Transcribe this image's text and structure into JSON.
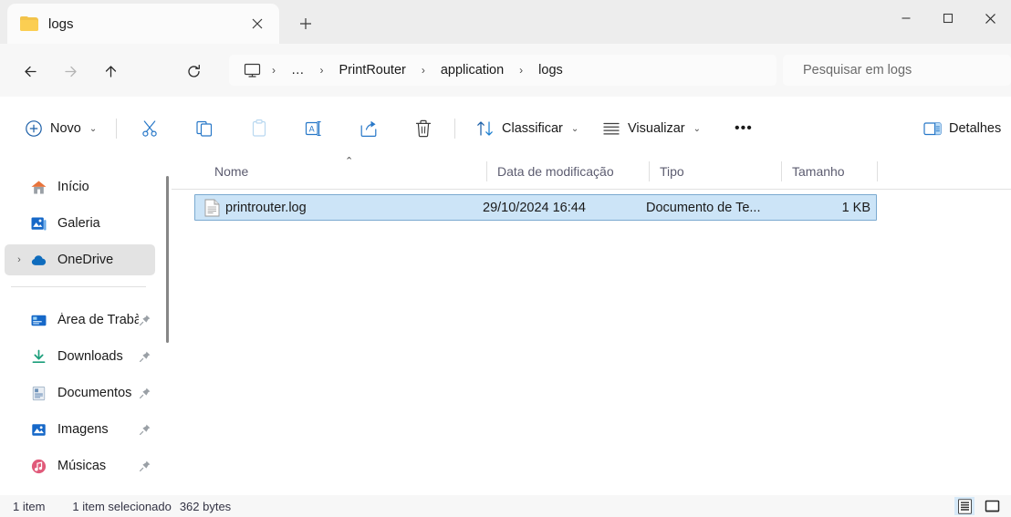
{
  "window": {
    "tab_title": "logs",
    "tab_icon": "folder-icon",
    "close_tab_label": "×",
    "new_tab_label": "+",
    "minimize_label": "─",
    "maximize_label": "□",
    "close_label": "✕"
  },
  "nav": {
    "back": "←",
    "forward": "→",
    "up": "↑",
    "refresh": "↻",
    "breadcrumb": [
      {
        "label": "",
        "icon": "this-pc-icon"
      },
      {
        "label": "…",
        "icon": ""
      },
      {
        "label": "PrintRouter",
        "icon": ""
      },
      {
        "label": "application",
        "icon": ""
      },
      {
        "label": "logs",
        "icon": ""
      }
    ],
    "separator": "›"
  },
  "search": {
    "placeholder": "Pesquisar em logs",
    "value": ""
  },
  "toolbar": {
    "new_label": "Novo",
    "cut_label": "",
    "copy_label": "",
    "paste_label": "",
    "rename_label": "",
    "share_label": "",
    "delete_label": "",
    "sort_label": "Classificar",
    "view_label": "Visualizar",
    "more_label": "•••",
    "details_label": "Detalhes",
    "chevron": "⌄"
  },
  "sidebar": {
    "items": [
      {
        "label": "Início",
        "icon": "home-icon",
        "pinned": false,
        "expandable": false,
        "selected": false
      },
      {
        "label": "Galeria",
        "icon": "gallery-icon",
        "pinned": false,
        "expandable": false,
        "selected": false
      },
      {
        "label": "OneDrive",
        "icon": "cloud-icon",
        "pinned": false,
        "expandable": true,
        "selected": true
      },
      {
        "label": "Área de Trabà",
        "icon": "desktop-icon",
        "pinned": true,
        "expandable": false,
        "selected": false
      },
      {
        "label": "Downloads",
        "icon": "download-icon",
        "pinned": true,
        "expandable": false,
        "selected": false
      },
      {
        "label": "Documentos",
        "icon": "document-icon",
        "pinned": true,
        "expandable": false,
        "selected": false
      },
      {
        "label": "Imagens",
        "icon": "picture-icon",
        "pinned": true,
        "expandable": false,
        "selected": false
      },
      {
        "label": "Músicas",
        "icon": "music-icon",
        "pinned": true,
        "expandable": false,
        "selected": false
      }
    ],
    "expand_chevron": "›"
  },
  "filelist": {
    "columns": [
      {
        "label": "Nome",
        "sorted": true,
        "sort_dir": "asc"
      },
      {
        "label": "Data de modificação",
        "sorted": false,
        "sort_dir": ""
      },
      {
        "label": "Tipo",
        "sorted": false,
        "sort_dir": ""
      },
      {
        "label": "Tamanho",
        "sorted": false,
        "sort_dir": ""
      }
    ],
    "sort_caret": "⌃",
    "rows": [
      {
        "name": "printrouter.log",
        "modified": "29/10/2024 16:44",
        "type": "Documento de Te...",
        "size": "1 KB",
        "icon": "text-file-icon",
        "selected": true
      }
    ]
  },
  "statusbar": {
    "item_count": "1 item",
    "selection_count": "1 item selecionado",
    "selection_size": "362 bytes",
    "view_details_label": "",
    "view_large_icons_label": ""
  },
  "colors": {
    "titlebar_bg": "#ededed",
    "navbar_bg": "#f7f7f7",
    "selection_bg": "#cce4f7",
    "selection_border": "#7aa9d0",
    "sidebar_selected_bg": "#e3e3e3",
    "accent_blue": "#0f6cbd",
    "folder_yellow": "#fbce52"
  }
}
